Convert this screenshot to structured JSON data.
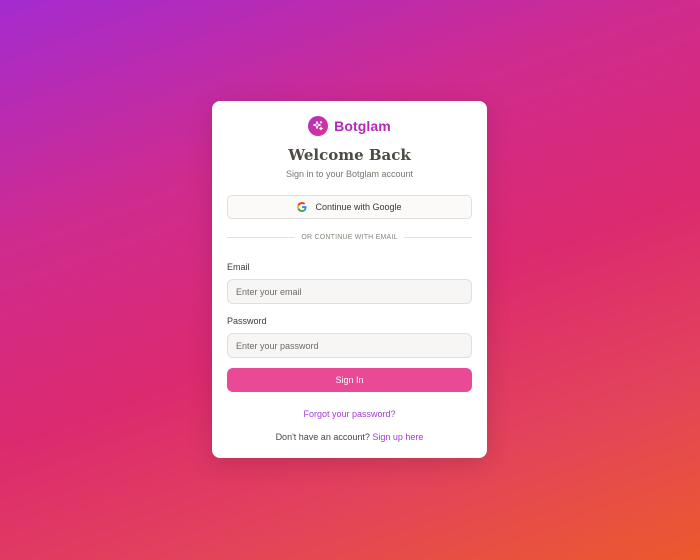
{
  "brand": {
    "name": "Botglam",
    "logo_icon": "sparkles-icon",
    "color": "#b42ab6"
  },
  "header": {
    "title": "Welcome Back",
    "subtitle": "Sign in to your Botglam account"
  },
  "google_button": {
    "label": "Continue with Google",
    "icon": "google-icon"
  },
  "divider": {
    "text": "OR CONTINUE WITH EMAIL"
  },
  "form": {
    "email": {
      "label": "Email",
      "placeholder": "Enter your email",
      "value": ""
    },
    "password": {
      "label": "Password",
      "placeholder": "Enter your password",
      "value": ""
    },
    "submit_label": "Sign In"
  },
  "links": {
    "forgot_password": "Forgot your password?",
    "signup_prompt": "Don't have an account?",
    "signup_link": "Sign up here"
  },
  "colors": {
    "accent": "#ea4a95",
    "link": "#a23ad6"
  }
}
